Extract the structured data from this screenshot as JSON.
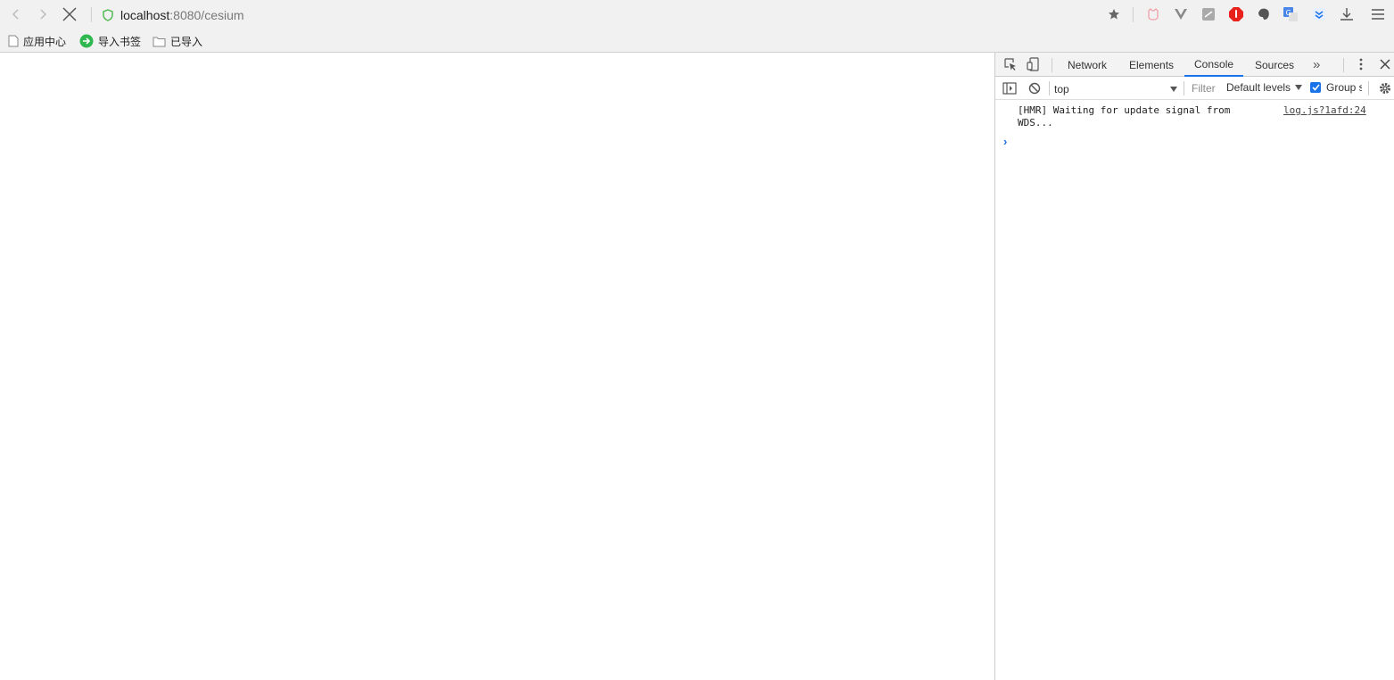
{
  "browser": {
    "url_host": "localhost",
    "url_rest": ":8080/cesium",
    "icons": [
      "back-icon",
      "forward-icon",
      "stop-icon",
      "secure-shield-icon",
      "bookmark-star-icon",
      "downloads-icon",
      "menu-icon"
    ]
  },
  "bookmarks": [
    {
      "label": "应用中心",
      "icon": "page-icon"
    },
    {
      "label": "导入书签",
      "icon": "import-arrow-icon"
    },
    {
      "label": "已导入",
      "icon": "folder-icon"
    }
  ],
  "devtools": {
    "tabs": [
      "Network",
      "Elements",
      "Console",
      "Sources"
    ],
    "active_tab": "Console",
    "more_tabs": "»",
    "console": {
      "context": "top",
      "filter_placeholder": "Filter",
      "levels": "Default levels",
      "group_label": "Group similar",
      "messages": [
        {
          "text": "[HMR] Waiting for update signal from WDS...",
          "source": "log.js?1afd:24"
        }
      ],
      "prompt": "›"
    }
  },
  "colors": {
    "accent": "#1a73e8",
    "toolbar_bg": "#f1f1f1",
    "border": "#cccccc"
  }
}
